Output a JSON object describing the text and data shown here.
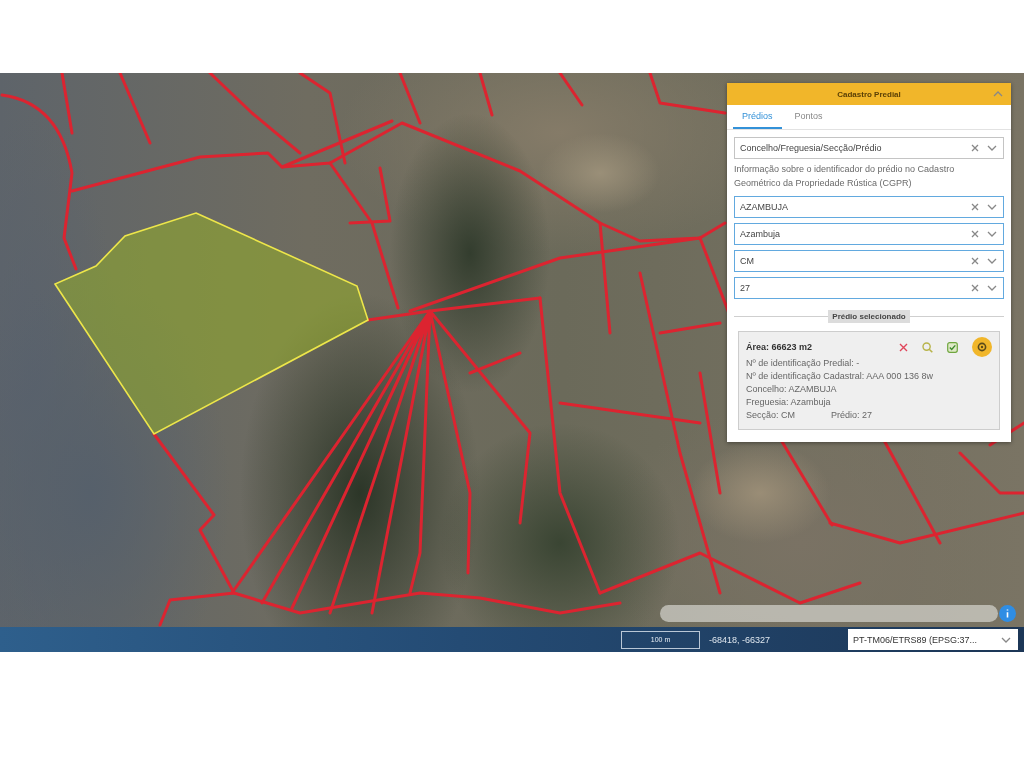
{
  "panel": {
    "title": "Cadastro Predial",
    "expanded": true,
    "tabs": [
      {
        "label": "Prédios",
        "selected": true
      },
      {
        "label": "Pontos",
        "selected": false
      }
    ],
    "search_type": {
      "value": "Concelho/Freguesia/Secção/Prédio"
    },
    "help_text": "Informação sobre o identificador do prédio no Cadastro Geométrico da Propriedade Rústica (CGPR)",
    "fields": [
      {
        "value": "AZAMBUJA",
        "highlighted": true
      },
      {
        "value": "Azambuja",
        "highlighted": true
      },
      {
        "value": "CM",
        "highlighted": true
      },
      {
        "value": "27",
        "highlighted": true
      }
    ],
    "section_label": "Prédio selecionado",
    "selected_parcel": {
      "area": "Área: 66623 m2",
      "details": [
        "Nº de identificação Predial: -",
        "Nº de identificação Cadastral: AAA 000 136 8w",
        "Concelho: AZAMBUJA",
        "Freguesia: Azambuja"
      ],
      "section": "Secção: CM",
      "parcel": "Prédio: 27"
    }
  },
  "bottom_bar": {
    "scale": "100 m",
    "coordinates": "-68418, -66327",
    "projection": "PT-TM06/ETRS89 (EPSG:37..."
  }
}
